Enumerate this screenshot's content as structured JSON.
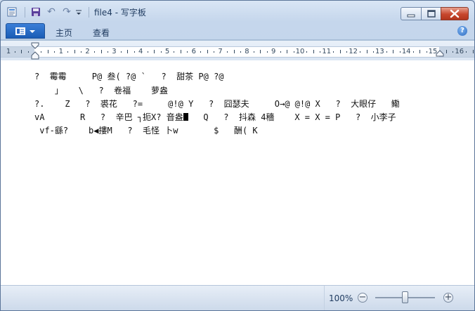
{
  "window": {
    "title": "file4 - 写字板"
  },
  "ribbon": {
    "tabs": [
      "主页",
      "查看"
    ],
    "help": "?"
  },
  "ruler": {
    "numbers": [
      "1",
      "1",
      "2",
      "3",
      "4",
      "5",
      "6",
      "7",
      "8",
      "9",
      "10",
      "11",
      "12",
      "13",
      "14",
      "15",
      "16"
    ]
  },
  "document": {
    "lines": [
      "?  霉霉     P@ 叁( ?@ `   ?  甜茶 P@ ?@",
      "    」   \\   ?  卷福    萝盎",
      "?.    Z   ?  裘花   ?=     @!@ Y   ?  囧瑟夫     O→@ @!@ X   ?  大眼仔   鳓",
      "vA       R   ?  辛巴 ┐扼X? 音盎",
      " vf-繇?    b◀摟M   ?  毛怪 卜w       $   酬( K"
    ],
    "line4_tail": "   Q   ?  抖森 4穡    X = X = P   ?  小李子"
  },
  "status": {
    "zoom": "100%",
    "zoom_level_percent": 100
  }
}
